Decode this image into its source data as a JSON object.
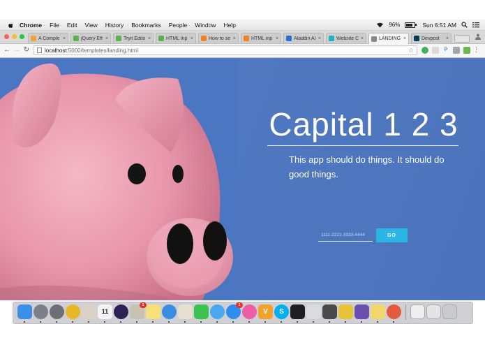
{
  "menubar": {
    "app_name": "Chrome",
    "items": [
      "File",
      "Edit",
      "View",
      "History",
      "Bookmarks",
      "People",
      "Window",
      "Help"
    ],
    "battery": "96%",
    "clock": "Sun 6:51 AM"
  },
  "tabs": [
    {
      "title": "A Comple",
      "icon": "star-icon",
      "color": "#f2a33a"
    },
    {
      "title": "jQuery Eff",
      "icon": "w3-icon",
      "color": "#5ab34b"
    },
    {
      "title": "Tryit Edito",
      "icon": "w3-icon",
      "color": "#5ab34b"
    },
    {
      "title": "HTML Inp",
      "icon": "w3-icon",
      "color": "#5ab34b"
    },
    {
      "title": "How to se",
      "icon": "so-icon",
      "color": "#f48024"
    },
    {
      "title": "HTML inp",
      "icon": "so-icon",
      "color": "#f48024"
    },
    {
      "title": "Aladdin Al",
      "icon": "aladdin-icon",
      "color": "#2b6fd1"
    },
    {
      "title": "Website C",
      "icon": "website-icon",
      "color": "#17b5c8"
    },
    {
      "title": "LANDING",
      "icon": "page-icon",
      "color": "#888888",
      "active": true
    },
    {
      "title": "Devpost",
      "icon": "devpost-icon",
      "color": "#003e54"
    }
  ],
  "address": {
    "host": "localhost",
    "path": ":5000/templates/landing.html"
  },
  "hero": {
    "title": "Capital 1 2 3",
    "text": "This app should do things. It should do good things."
  },
  "form": {
    "placeholder": "1111-2222-3333-4444",
    "value": "",
    "go_label": "GO"
  },
  "dock": {
    "calendar_day": "11",
    "mail_badge": "1",
    "appstore_badge": "1",
    "apps": [
      {
        "name": "finder-icon",
        "color": "#3b8fe6",
        "glyph": ""
      },
      {
        "name": "launchpad-icon",
        "color": "#7a7f88",
        "glyph": ""
      },
      {
        "name": "system-preferences-icon",
        "color": "#6c6f75",
        "glyph": ""
      },
      {
        "name": "chrome-icon",
        "color": "#e7b825",
        "glyph": ""
      },
      {
        "name": "preview-icon",
        "color": "#d9d2c5",
        "glyph": ""
      },
      {
        "name": "calendar-icon",
        "color": "#f4f4f4",
        "glyph": ""
      },
      {
        "name": "eclipse-icon",
        "color": "#2c2255",
        "glyph": ""
      },
      {
        "name": "photos-icon",
        "color": "#c9c2b2",
        "glyph": ""
      },
      {
        "name": "notes-icon",
        "color": "#f6e07b",
        "glyph": ""
      },
      {
        "name": "safari-icon",
        "color": "#3a8de2",
        "glyph": ""
      },
      {
        "name": "textedit-icon",
        "color": "#e6e0cf",
        "glyph": ""
      },
      {
        "name": "facetime-icon",
        "color": "#3cc24e",
        "glyph": ""
      },
      {
        "name": "messages-icon",
        "color": "#4aa8f2",
        "glyph": ""
      },
      {
        "name": "appstore-icon",
        "color": "#2f8cf0",
        "glyph": ""
      },
      {
        "name": "itunes-icon",
        "color": "#ef5da8",
        "glyph": ""
      },
      {
        "name": "vim-icon",
        "color": "#f2a12b",
        "glyph": "V"
      },
      {
        "name": "skype-icon",
        "color": "#00aff0",
        "glyph": "S"
      },
      {
        "name": "terminal-icon",
        "color": "#1e1e1e",
        "glyph": ""
      },
      {
        "name": "texteditor-icon",
        "color": "#d7dce3",
        "glyph": ""
      },
      {
        "name": "sublime-icon",
        "color": "#4a4a4a",
        "glyph": ""
      },
      {
        "name": "wunderlist-icon",
        "color": "#e8c33a",
        "glyph": ""
      },
      {
        "name": "viewer-icon",
        "color": "#6a4fb0",
        "glyph": ""
      },
      {
        "name": "stickies-icon",
        "color": "#f1d66a",
        "glyph": ""
      },
      {
        "name": "pinwheel-icon",
        "color": "#e35b3c",
        "glyph": ""
      }
    ],
    "right": [
      {
        "name": "document-stack-icon",
        "color": "#eeeeee"
      },
      {
        "name": "downloads-stack-icon",
        "color": "#e4e4e4"
      },
      {
        "name": "trash-icon",
        "color": "#c9cbcf"
      }
    ]
  }
}
